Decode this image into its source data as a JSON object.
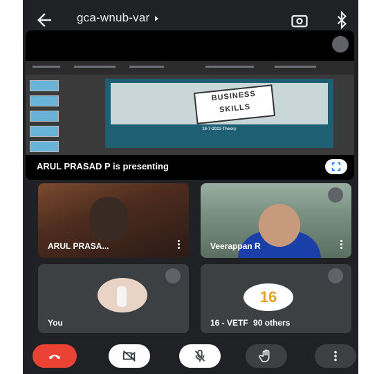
{
  "meeting": {
    "code": "gca-wnub-var"
  },
  "presentation": {
    "status": "ARUL PRASAD P is presenting",
    "slide_sign_line1": "BUSINESS",
    "slide_sign_line2": "SKILLS",
    "slide_title": "16-7-2021-Theory"
  },
  "participants": [
    {
      "name": "ARUL PRASA..."
    },
    {
      "name": "Veerappan R"
    },
    {
      "name": "You"
    },
    {
      "name": "16 - VETF",
      "extra": "90 others",
      "badge": "16"
    }
  ],
  "colors": {
    "end_call": "#ea4335",
    "background": "#202124",
    "tile": "#3c4043"
  },
  "icons": {
    "back": "arrow-left-icon",
    "switch_camera": "camera-switch-icon",
    "bluetooth": "bluetooth-icon",
    "fullscreen": "fullscreen-icon",
    "end_call": "phone-hangup-icon",
    "camera": "camera-off-icon",
    "mic": "mic-off-icon",
    "hand": "raise-hand-icon",
    "more": "more-vert-icon"
  }
}
